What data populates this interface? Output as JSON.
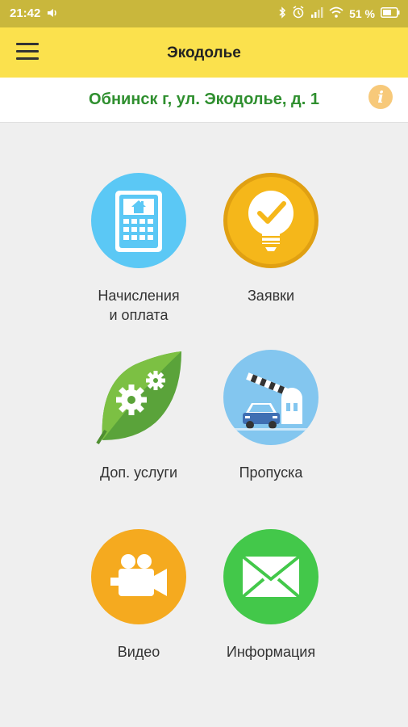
{
  "statusbar": {
    "time": "21:42",
    "battery_percent": "51 %"
  },
  "appbar": {
    "title": "Экодолье"
  },
  "address": {
    "text": "Обнинск г, ул. Экодолье, д. 1",
    "info_icon": "i"
  },
  "tiles": [
    {
      "label_line1": "Начисления",
      "label_line2": "и оплата",
      "icon": "calculator-house-icon",
      "color": "#5bc8f5"
    },
    {
      "label_line1": "Заявки",
      "label_line2": "",
      "icon": "lightbulb-check-icon",
      "color": "#f5b71a"
    },
    {
      "label_line1": "Доп. услуги",
      "label_line2": "",
      "icon": "leaf-gears-icon",
      "color": "#5aa33a"
    },
    {
      "label_line1": "Пропуска",
      "label_line2": "",
      "icon": "barrier-car-icon",
      "color": "#83c6ef"
    },
    {
      "label_line1": "Видео",
      "label_line2": "",
      "icon": "video-camera-icon",
      "color": "#f5aa1f"
    },
    {
      "label_line1": "Информация",
      "label_line2": "",
      "icon": "envelope-icon",
      "color": "#43c84a"
    }
  ]
}
